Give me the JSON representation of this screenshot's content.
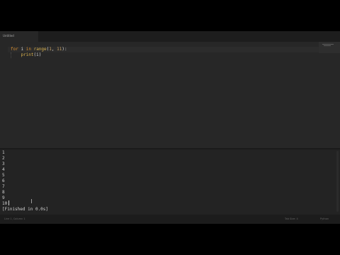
{
  "tab": {
    "title": "Untitled"
  },
  "editor": {
    "line1": {
      "kw_for": "for",
      "var_i": "i",
      "kw_in": "in",
      "fn_range": "range",
      "paren_open": "(",
      "num_start": "1",
      "comma": ", ",
      "num_end": "11",
      "tail": "):"
    },
    "line2": {
      "indent": "    ",
      "fn_print": "print",
      "args": "(i)"
    }
  },
  "output": {
    "lines": [
      "1",
      "2",
      "3",
      "4",
      "5",
      "6",
      "7",
      "8",
      "9",
      "10"
    ],
    "finished": "[Finished in 0.0s]"
  },
  "status": {
    "left": "Line 1, Column 1",
    "right_tab": "Tab Size: 4",
    "right_syntax": "Python"
  },
  "colors": {
    "keyword": "#d78d2e",
    "function": "#d9b24f",
    "number": "#c7a064",
    "background": "#272727"
  }
}
